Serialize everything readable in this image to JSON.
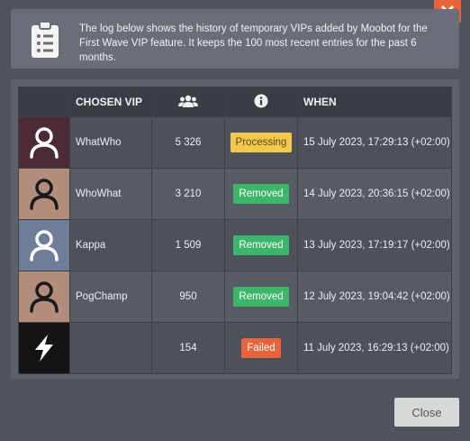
{
  "info": {
    "text": "The log below shows the history of temporary VIPs added by Moobot for the First Wave VIP feature. It keeps the 100 most recent entries for the past 6 months."
  },
  "table": {
    "headers": {
      "chosen_vip": "CHOSEN VIP",
      "when": "WHEN",
      "users_icon": "users-icon",
      "info_icon": "info-circle-icon"
    },
    "rows": [
      {
        "avatar": "user-silhouette-icon",
        "avatar_bg": "#4a2a34",
        "icon_color": "#ffffff",
        "name": "WhatWho",
        "count": "5 326",
        "status": "Processing",
        "status_color": "#f2c94c",
        "status_text_color": "#5a4a10",
        "when": "15 July 2023, 17:29:13 (+02:00)"
      },
      {
        "avatar": "user-silhouette-icon",
        "avatar_bg": "#b48c7c",
        "icon_color": "#1a1a1a",
        "name": "WhoWhat",
        "count": "3 210",
        "status": "Removed",
        "status_color": "#3bb66a",
        "status_text_color": "#ffffff",
        "when": "14 July 2023, 20:36:15 (+02:00)"
      },
      {
        "avatar": "user-silhouette-icon",
        "avatar_bg": "#6f7d98",
        "icon_color": "#ffffff",
        "name": "Kappa",
        "count": "1 509",
        "status": "Removed",
        "status_color": "#3bb66a",
        "status_text_color": "#ffffff",
        "when": "13 July 2023, 17:19:17 (+02:00)"
      },
      {
        "avatar": "user-silhouette-icon",
        "avatar_bg": "#b48c7c",
        "icon_color": "#1a1a1a",
        "name": "PogChamp",
        "count": "950",
        "status": "Removed",
        "status_color": "#3bb66a",
        "status_text_color": "#ffffff",
        "when": "12 July 2023, 19:04:42 (+02:00)"
      },
      {
        "avatar": "lightning-bolt-icon",
        "avatar_bg": "#141414",
        "icon_color": "#ffffff",
        "name": "",
        "count": "154",
        "status": "Failed",
        "status_color": "#e8643c",
        "status_text_color": "#ffffff",
        "when": "11 July 2023, 16:29:13 (+02:00)"
      }
    ]
  },
  "footer": {
    "close_label": "Close"
  }
}
